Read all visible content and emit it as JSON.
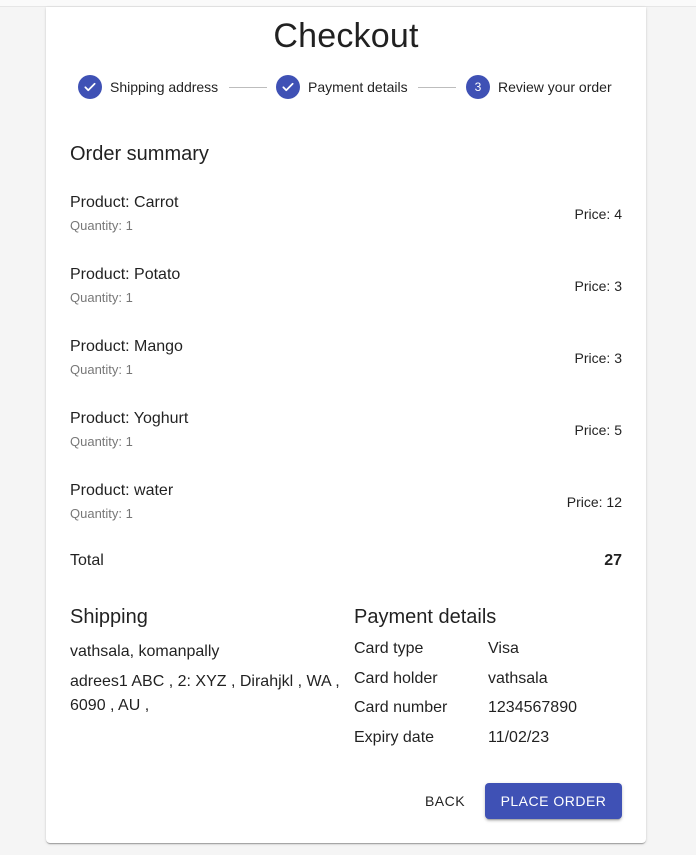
{
  "title": "Checkout",
  "steps": [
    {
      "label": "Shipping address",
      "status": "completed",
      "icon": "check-icon"
    },
    {
      "label": "Payment details",
      "status": "completed",
      "icon": "check-icon"
    },
    {
      "label": "Review your order",
      "status": "active",
      "number": "3"
    }
  ],
  "order_summary": {
    "heading": "Order summary",
    "items": [
      {
        "name": "Product: Carrot",
        "quantity": "Quantity: 1",
        "price": "Price: 4"
      },
      {
        "name": "Product: Potato",
        "quantity": "Quantity: 1",
        "price": "Price: 3"
      },
      {
        "name": "Product: Mango",
        "quantity": "Quantity: 1",
        "price": "Price: 3"
      },
      {
        "name": "Product: Yoghurt",
        "quantity": "Quantity: 1",
        "price": "Price: 5"
      },
      {
        "name": "Product: water",
        "quantity": "Quantity: 1",
        "price": "Price: 12"
      }
    ],
    "total_label": "Total",
    "total_value": "27"
  },
  "shipping": {
    "heading": "Shipping",
    "name_line": "vathsala, komanpally",
    "address_line": "adrees1 ABC , 2: XYZ , Dirahjkl , WA , 6090 , AU ,"
  },
  "payment": {
    "heading": "Payment details",
    "rows": [
      {
        "label": "Card type",
        "value": "Visa"
      },
      {
        "label": "Card holder",
        "value": "vathsala"
      },
      {
        "label": "Card number",
        "value": "1234567890"
      },
      {
        "label": "Expiry date",
        "value": "11/02/23"
      }
    ]
  },
  "actions": {
    "back_label": "BACK",
    "place_order_label": "PLACE ORDER"
  },
  "colors": {
    "primary": "#3f51b5",
    "background": "#f5f5f5",
    "paper": "#ffffff"
  }
}
